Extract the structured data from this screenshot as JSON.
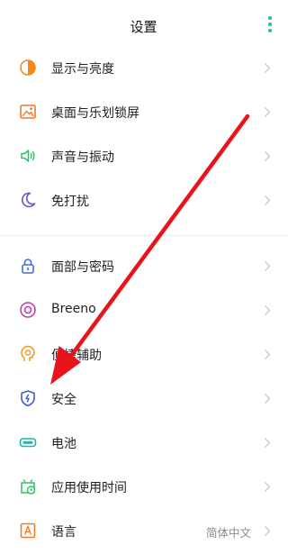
{
  "header": {
    "title": "设置"
  },
  "items": [
    {
      "label": "显示与亮度",
      "icon": "brightness-icon"
    },
    {
      "label": "桌面与乐划锁屏",
      "icon": "wallpaper-icon"
    },
    {
      "label": "声音与振动",
      "icon": "speaker-icon"
    },
    {
      "label": "免打扰",
      "icon": "moon-icon"
    },
    {
      "label": "面部与密码",
      "icon": "lock-icon"
    },
    {
      "label": "Breeno",
      "icon": "breeno-icon"
    },
    {
      "label": "便捷辅助",
      "icon": "assist-icon"
    },
    {
      "label": "安全",
      "icon": "shield-icon"
    },
    {
      "label": "电池",
      "icon": "battery-icon"
    },
    {
      "label": "应用使用时间",
      "icon": "app-time-icon"
    },
    {
      "label": "语言",
      "icon": "language-icon",
      "value": "简体中文"
    }
  ],
  "colors": {
    "accent": "#2bbf8a",
    "annotation_arrow": "#e8141c",
    "chevron": "#c8c8c8"
  }
}
